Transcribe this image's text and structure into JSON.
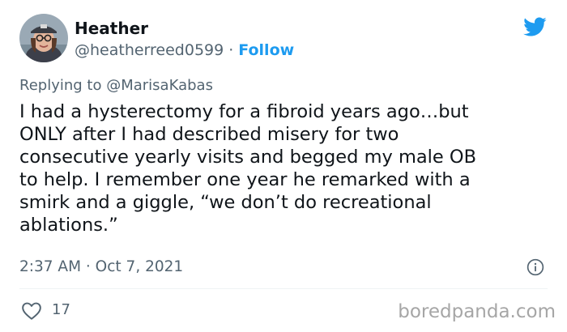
{
  "author": {
    "name": "Heather",
    "handle": "@heatherreed0599",
    "separator": "·",
    "follow_label": "Follow"
  },
  "reply": {
    "prefix": "Replying to",
    "mention": "@MarisaKabas"
  },
  "tweet": {
    "lines": [
      "I had a hysterectomy for a fibroid years ago…but",
      "ONLY after I had described misery for two",
      "consecutive yearly visits and begged my male OB",
      "to help. I remember one year he remarked with a",
      "smirk and a giggle, “we don’t do recreational",
      "ablations.”"
    ]
  },
  "meta": {
    "timestamp": "2:37 AM · Oct 7, 2021"
  },
  "actions": {
    "like_count": "17"
  },
  "watermark": "boredpanda.com",
  "colors": {
    "accent": "#1d9bf0",
    "text": "#0f1419",
    "muted": "#536471",
    "watermark": "#a6a6a6"
  },
  "icons": [
    "twitter-bird-icon",
    "info-icon",
    "heart-icon"
  ]
}
